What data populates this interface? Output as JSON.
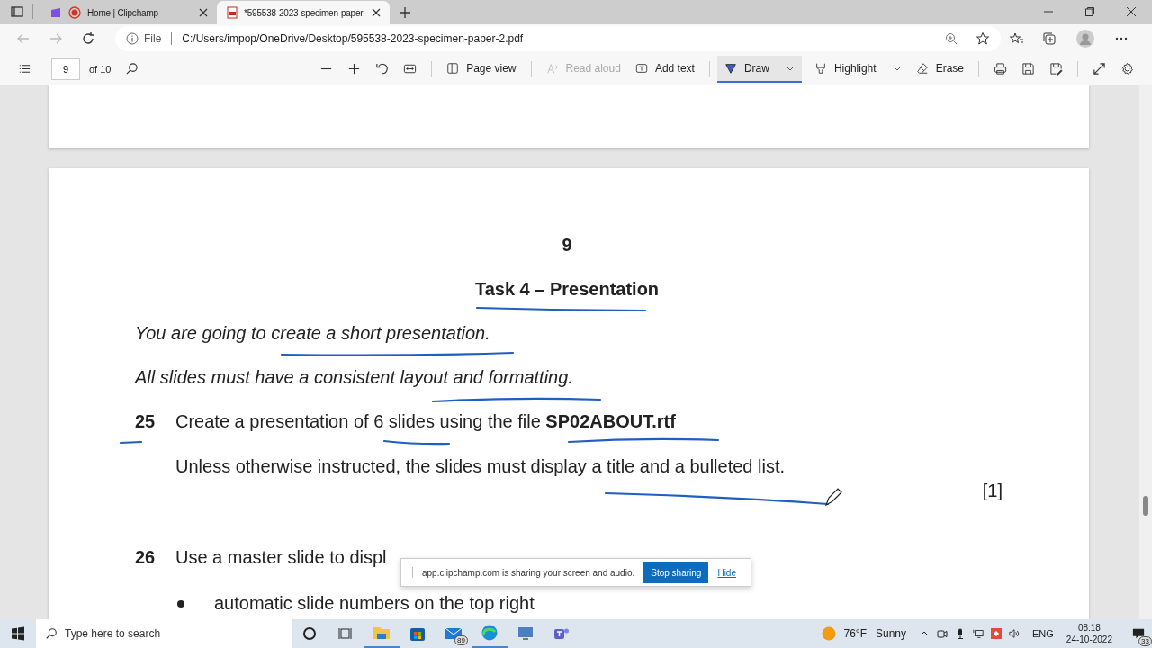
{
  "tabs": [
    {
      "title": "Home | Clipchamp",
      "selected": false,
      "recording": true
    },
    {
      "title": "*595538-2023-specimen-paper-",
      "selected": true,
      "recording": false
    }
  ],
  "address": {
    "scheme": "File",
    "url": "C:/Users/impop/OneDrive/Desktop/595538-2023-specimen-paper-2.pdf"
  },
  "pdf_toolbar": {
    "page": "9",
    "of": "of 10",
    "buttons": [
      {
        "label": "Page view",
        "selected": false,
        "disabled": false
      },
      {
        "label": "Read aloud",
        "selected": false,
        "disabled": true
      },
      {
        "label": "Add text",
        "selected": false,
        "disabled": false
      },
      {
        "label": "Draw",
        "selected": true,
        "disabled": false
      },
      {
        "label": "Highlight",
        "selected": false,
        "disabled": false
      },
      {
        "label": "Erase",
        "selected": false,
        "disabled": false
      }
    ]
  },
  "document": {
    "page_number": "9",
    "title": "Task 4 – Presentation",
    "intro": [
      "You are going to create a short presentation.",
      "All slides must have a consistent layout and formatting."
    ],
    "q25": {
      "number": "25",
      "text": "Create a presentation of 6 slides using the file **SP02ABOUT.rtf**",
      "note": "Unless otherwise instructed, the slides must display a title and a bulleted list.",
      "mark": "[1]"
    },
    "q26": {
      "number": "26",
      "text": "Use a master slide to displ"
    },
    "bullets": [
      "automatic slide numbers on the top right"
    ]
  },
  "share_bar": {
    "message": "app.clipchamp.com is sharing your screen and audio.",
    "button": "Stop sharing",
    "link": "Hide"
  },
  "taskbar": {
    "search_placeholder": "Type here to search",
    "mail_badge": "89",
    "temperature": "76°F",
    "weather": "Sunny",
    "language": "ENG",
    "time": "08:18",
    "date": "24-10-2022",
    "notifications": "33"
  }
}
